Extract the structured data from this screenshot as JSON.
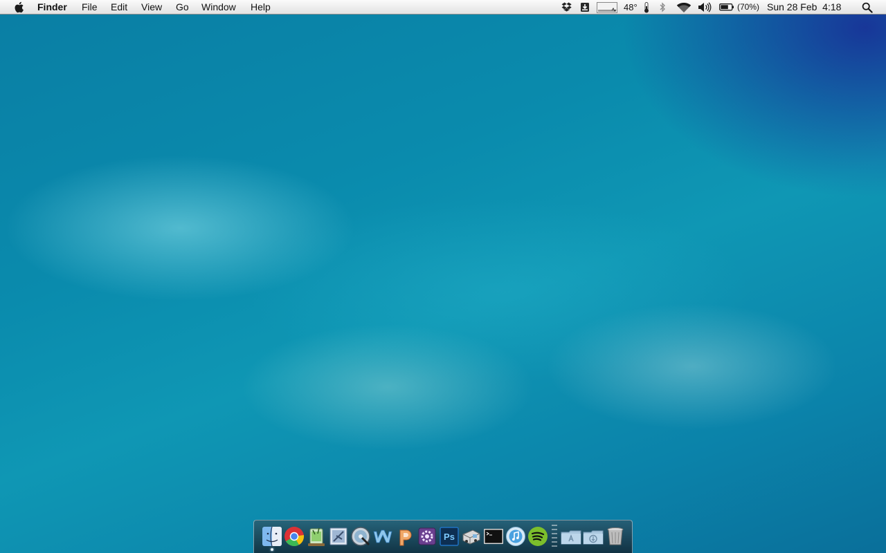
{
  "menubar": {
    "apple_menu_icon": "apple-logo-icon",
    "app_name": "Finder",
    "menus": [
      "File",
      "Edit",
      "View",
      "Go",
      "Window",
      "Help"
    ],
    "status": {
      "icons": [
        "dropbox-icon",
        "install-icon",
        "activity-monitor-icon",
        "thermometer-icon",
        "bluetooth-icon",
        "wifi-icon",
        "volume-icon",
        "battery-icon",
        "spotlight-icon"
      ],
      "temperature": "48°",
      "battery_percent": "(70%)",
      "clock": "Sun 28 Feb  4:18"
    }
  },
  "desktop": {
    "wallpaper_colors": [
      "#0a7ea4",
      "#0f97b4",
      "#8ce1eb",
      "#1f2d96"
    ]
  },
  "dock": {
    "apps": [
      {
        "icon": "finder-icon",
        "running": true
      },
      {
        "icon": "chrome-icon",
        "running": false
      },
      {
        "icon": "mojito-app-icon",
        "running": false
      },
      {
        "icon": "mail-app-icon",
        "running": false
      },
      {
        "icon": "web-dvd-icon",
        "running": false
      },
      {
        "icon": "word-icon",
        "running": false
      },
      {
        "icon": "powerpoint-icon",
        "running": false
      },
      {
        "icon": "gear-app-icon",
        "running": false
      },
      {
        "icon": "photoshop-icon",
        "running": false
      },
      {
        "icon": "delivery-truck-icon",
        "running": false
      },
      {
        "icon": "terminal-icon",
        "running": false
      },
      {
        "icon": "itunes-icon",
        "running": false
      },
      {
        "icon": "spotify-icon",
        "running": false
      }
    ],
    "ps_label": "Ps",
    "stacks": [
      {
        "icon": "applications-folder-icon"
      },
      {
        "icon": "downloads-folder-icon"
      }
    ],
    "trash": {
      "icon": "trash-icon"
    }
  }
}
